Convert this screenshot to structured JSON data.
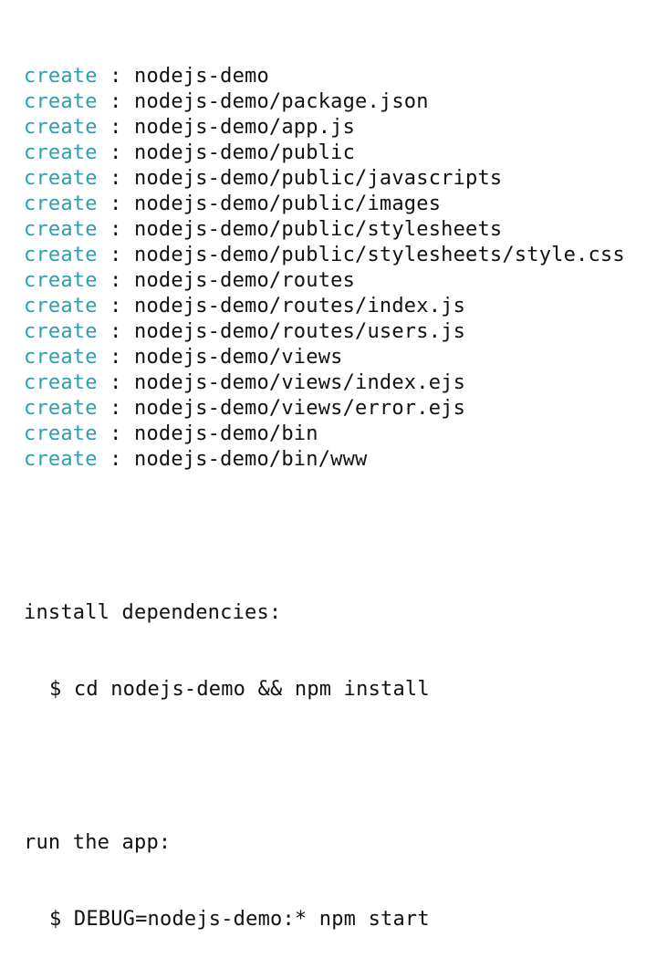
{
  "colors": {
    "create_verb": "#2aa1b3",
    "text": "#111111",
    "background": "#ffffff"
  },
  "create_lines": [
    {
      "verb": "create",
      "sep": " : ",
      "path": "nodejs-demo"
    },
    {
      "verb": "create",
      "sep": " : ",
      "path": "nodejs-demo/package.json"
    },
    {
      "verb": "create",
      "sep": " : ",
      "path": "nodejs-demo/app.js"
    },
    {
      "verb": "create",
      "sep": " : ",
      "path": "nodejs-demo/public"
    },
    {
      "verb": "create",
      "sep": " : ",
      "path": "nodejs-demo/public/javascripts"
    },
    {
      "verb": "create",
      "sep": " : ",
      "path": "nodejs-demo/public/images"
    },
    {
      "verb": "create",
      "sep": " : ",
      "path": "nodejs-demo/public/stylesheets"
    },
    {
      "verb": "create",
      "sep": " : ",
      "path": "nodejs-demo/public/stylesheets/style.css"
    },
    {
      "verb": "create",
      "sep": " : ",
      "path": "nodejs-demo/routes"
    },
    {
      "verb": "create",
      "sep": " : ",
      "path": "nodejs-demo/routes/index.js"
    },
    {
      "verb": "create",
      "sep": " : ",
      "path": "nodejs-demo/routes/users.js"
    },
    {
      "verb": "create",
      "sep": " : ",
      "path": "nodejs-demo/views"
    },
    {
      "verb": "create",
      "sep": " : ",
      "path": "nodejs-demo/views/index.ejs"
    },
    {
      "verb": "create",
      "sep": " : ",
      "path": "nodejs-demo/views/error.ejs"
    },
    {
      "verb": "create",
      "sep": " : ",
      "path": "nodejs-demo/bin"
    },
    {
      "verb": "create",
      "sep": " : ",
      "path": "nodejs-demo/bin/www"
    }
  ],
  "install": {
    "heading": "install dependencies:",
    "command": "$ cd nodejs-demo && npm install"
  },
  "run": {
    "heading": "run the app:",
    "command": "$ DEBUG=nodejs-demo:* npm start"
  }
}
